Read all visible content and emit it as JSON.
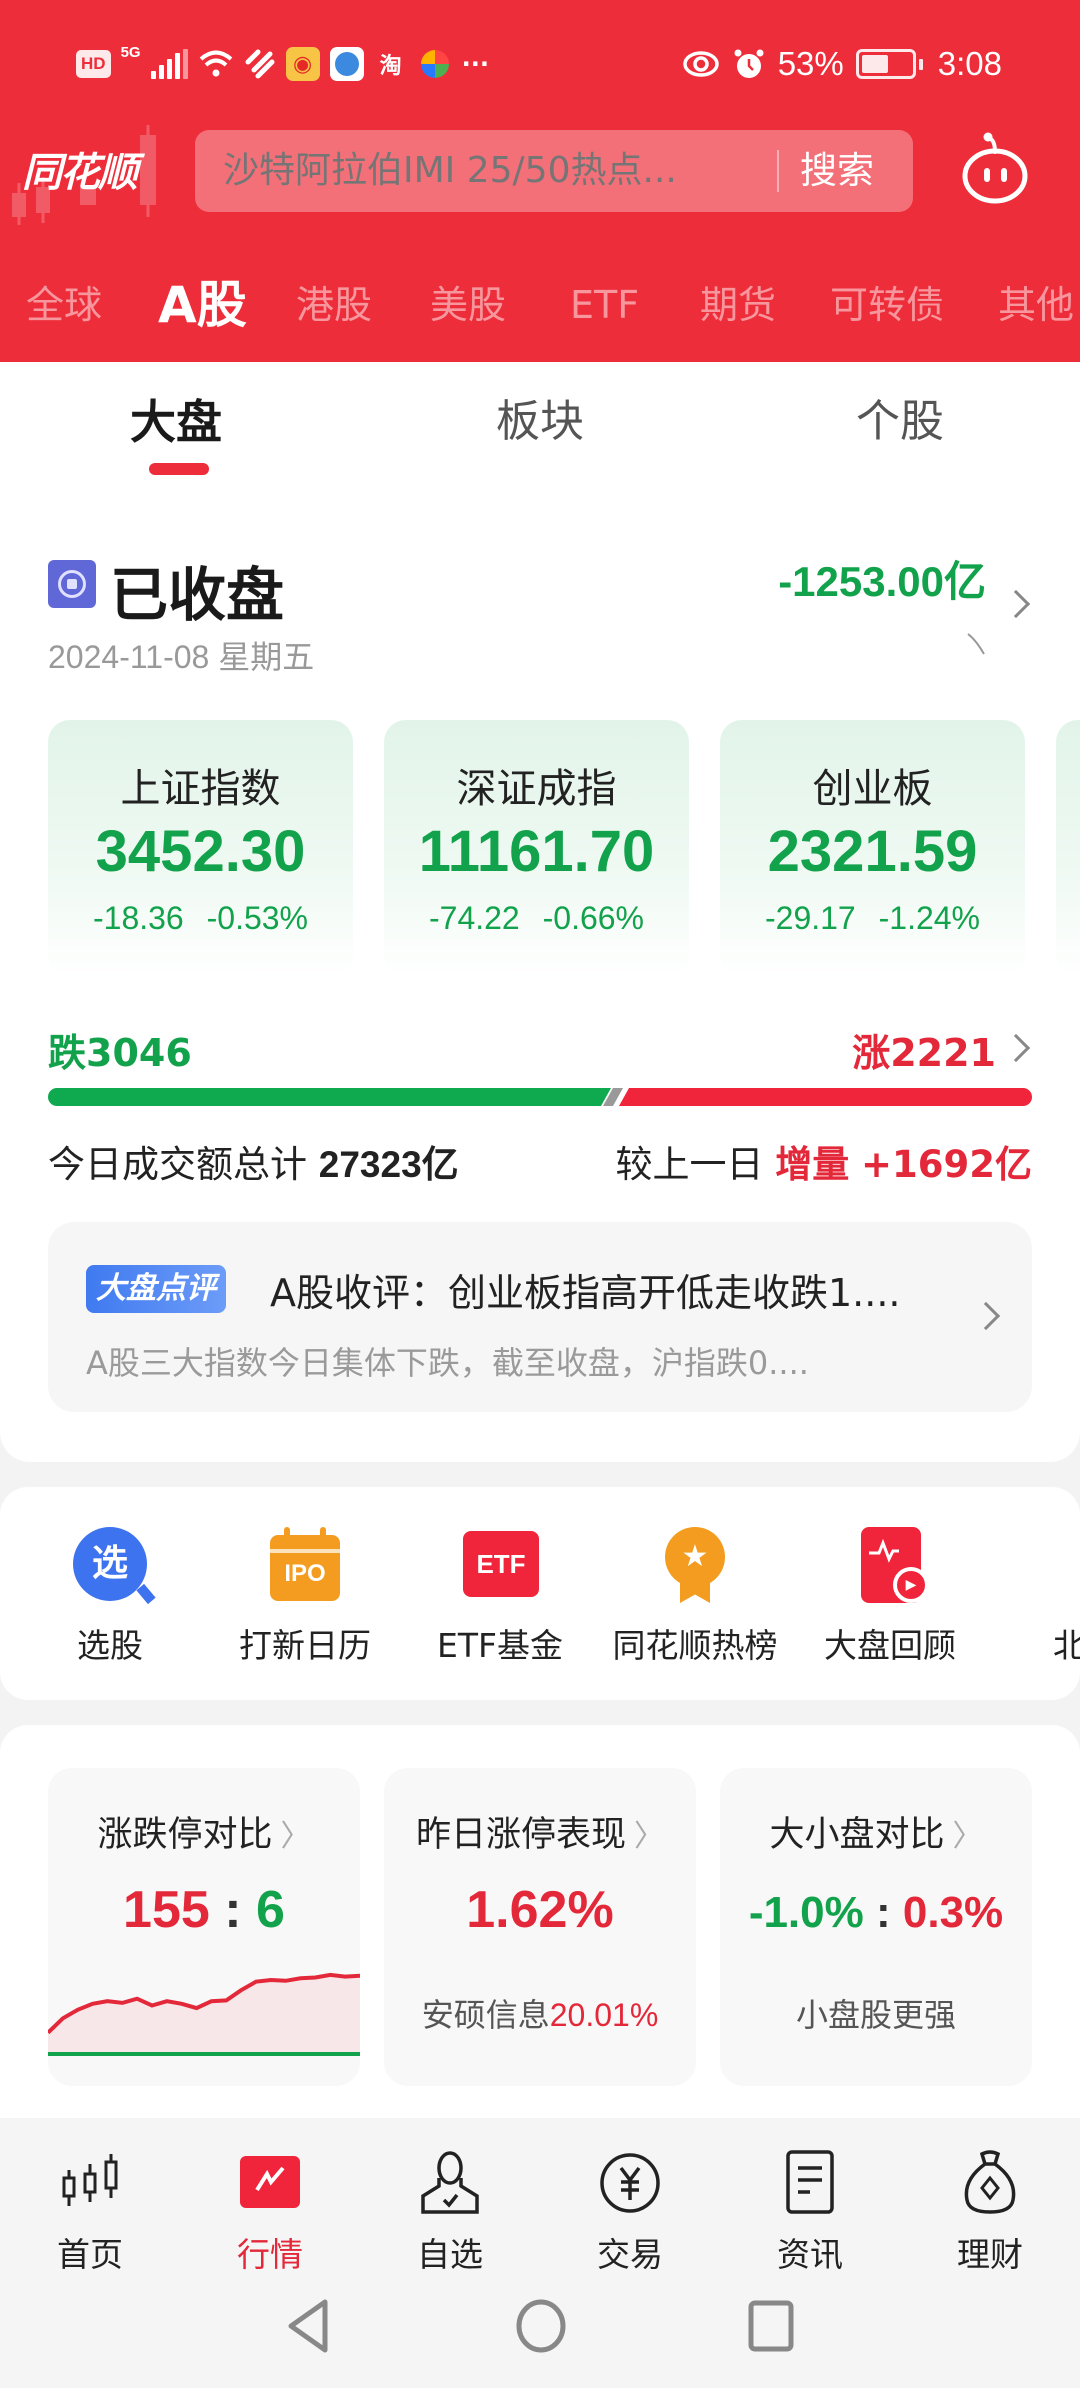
{
  "status_bar": {
    "left_icons": [
      "hd-icon",
      "5g-signal-icon",
      "wifi-icon",
      "app-notification-icon",
      "weibo-icon",
      "browser-icon",
      "taobao-icon",
      "colorful-app-icon",
      "more-dots-icon"
    ],
    "hd": "HD",
    "network": "5G",
    "taobao": "淘",
    "more": "···",
    "battery": "53%",
    "time": "3:08"
  },
  "header": {
    "logo": "同花顺",
    "search_placeholder": "沙特阿拉伯IMI 25/50热点...",
    "search_button": "搜索",
    "market_tabs": [
      {
        "label": "全球",
        "active": false
      },
      {
        "label": "A股",
        "active": true
      },
      {
        "label": "港股",
        "active": false
      },
      {
        "label": "美股",
        "active": false
      },
      {
        "label": "ETF",
        "active": false
      },
      {
        "label": "期货",
        "active": false
      },
      {
        "label": "可转债",
        "active": false
      },
      {
        "label": "其他",
        "active": false
      }
    ]
  },
  "sub_tabs": [
    {
      "label": "大盘",
      "active": true
    },
    {
      "label": "板块",
      "active": false
    },
    {
      "label": "个股",
      "active": false
    }
  ],
  "market_status": {
    "title": "已收盘",
    "date": "2024-11-08 星期五",
    "net_flow": "-1253.00亿"
  },
  "indices": [
    {
      "name": "上证指数",
      "value": "3452.30",
      "change": "-18.36",
      "pct": "-0.53%"
    },
    {
      "name": "深证成指",
      "value": "11161.70",
      "change": "-74.22",
      "pct": "-0.66%"
    },
    {
      "name": "创业板",
      "value": "2321.59",
      "change": "-29.17",
      "pct": "-1.24%"
    }
  ],
  "breadth": {
    "down_label": "跌3046",
    "up_label": "涨2221",
    "down": 3046,
    "up": 2221
  },
  "turnover": {
    "label": "今日成交额总计",
    "value": "27323亿",
    "compare_label": "较上一日",
    "delta_label": "增量",
    "delta": "+1692亿"
  },
  "commentary": {
    "badge": "大盘点评",
    "title": "A股收评：创业板指高开低走收跌1....",
    "summary": "A股三大指数今日集体下跌，截至收盘，沪指跌0...."
  },
  "shortcuts": [
    {
      "label": "选股",
      "icon": "stock-picker-icon",
      "glyph": "选"
    },
    {
      "label": "打新日历",
      "icon": "ipo-calendar-icon",
      "glyph": "IPO"
    },
    {
      "label": "ETF基金",
      "icon": "etf-fund-icon",
      "glyph": "ETF"
    },
    {
      "label": "同花顺热榜",
      "icon": "hot-list-medal-icon",
      "glyph": "★"
    },
    {
      "label": "大盘回顾",
      "icon": "market-review-icon",
      "glyph": "▶"
    },
    {
      "label": "北交",
      "icon": "beijing-exchange-icon",
      "glyph": "◆"
    }
  ],
  "stats": [
    {
      "title": "涨跌停对比",
      "limit_up": "155",
      "sep": ":",
      "limit_down": "6"
    },
    {
      "title": "昨日涨停表现",
      "value": "1.62%",
      "sub_name": "安硕信息",
      "sub_value": "20.01%"
    },
    {
      "title": "大小盘对比",
      "large": "-1.0%",
      "sep": ":",
      "small": "0.3%",
      "sub": "小盘股更强"
    }
  ],
  "bottom_nav": [
    {
      "label": "首页",
      "icon": "candlestick-home-icon",
      "active": false
    },
    {
      "label": "行情",
      "icon": "market-chart-icon",
      "active": true
    },
    {
      "label": "自选",
      "icon": "watchlist-person-icon",
      "active": false
    },
    {
      "label": "交易",
      "icon": "yen-trade-icon",
      "active": false
    },
    {
      "label": "资讯",
      "icon": "news-document-icon",
      "active": false
    },
    {
      "label": "理财",
      "icon": "money-bag-icon",
      "active": false
    }
  ],
  "colors": {
    "brand_red": "#ee2d3a",
    "up_red": "#e3283a",
    "down_green": "#12a24c"
  }
}
